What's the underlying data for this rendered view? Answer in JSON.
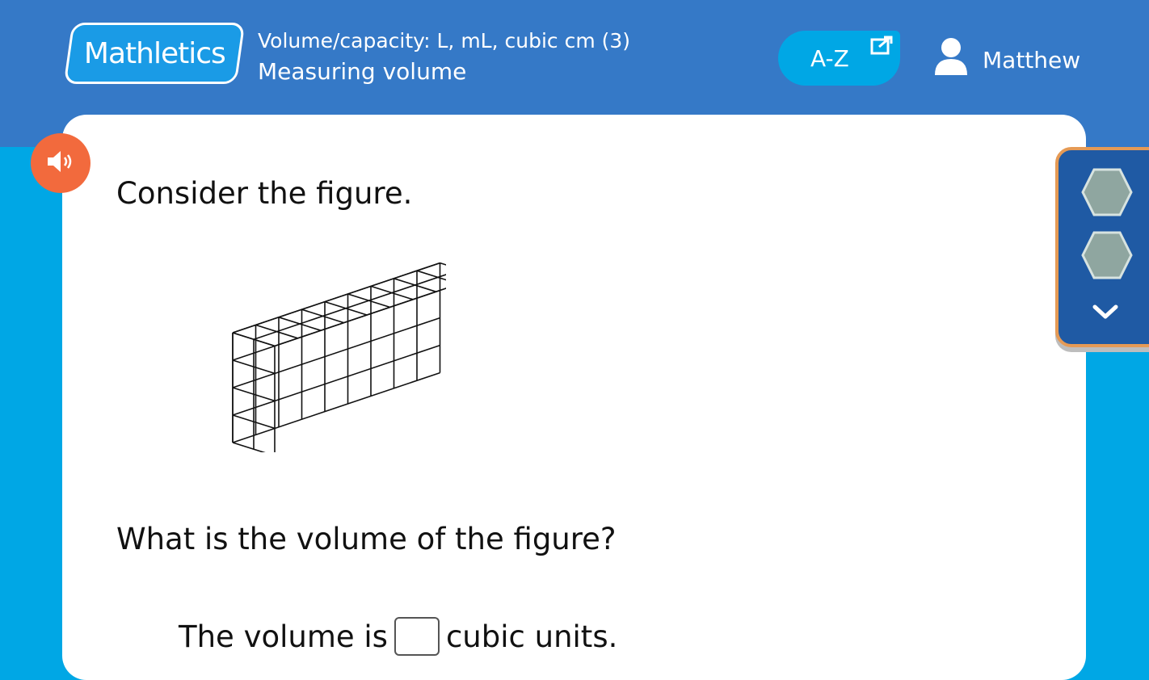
{
  "header": {
    "logo_text": "Mathletics",
    "topic_title": "Volume/capacity: L, mL, cubic cm (3)",
    "topic_subtitle": "Measuring volume",
    "az_label": "A-Z",
    "user_name": "Matthew"
  },
  "question": {
    "prompt": "Consider the figure.",
    "text": "What is the volume of the figure?",
    "answer_prefix": "The volume is",
    "answer_value": "",
    "answer_suffix": "cubic units."
  },
  "figure": {
    "type": "rectangular-prism-of-unit-cubes",
    "length_cubes": 9,
    "width_cubes": 2,
    "height_cubes": 4
  },
  "icons": {
    "audio": "speaker-icon",
    "external": "external-link-icon",
    "user": "user-icon",
    "progress": [
      "hexagon-icon",
      "hexagon-icon"
    ],
    "expand": "chevron-down-icon"
  },
  "colors": {
    "header_bg": "#3579c7",
    "page_bg": "#00a7e5",
    "audio_button": "#f26a3d",
    "side_panel": "#1f5aa4",
    "side_panel_border": "#e59a55"
  }
}
